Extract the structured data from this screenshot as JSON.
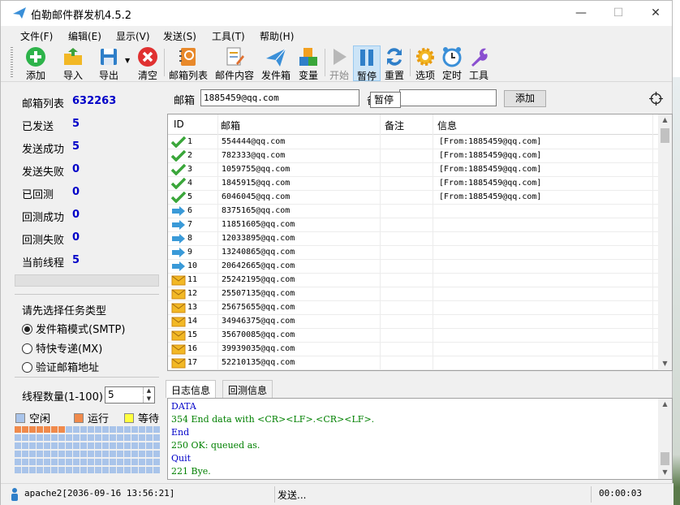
{
  "window": {
    "title": "伯勒邮件群发机4.5.2",
    "minimize": "—",
    "maximize": "☐",
    "close": "✕"
  },
  "menu": [
    "文件(F)",
    "编辑(E)",
    "显示(V)",
    "发送(S)",
    "工具(T)",
    "帮助(H)"
  ],
  "toolbar": {
    "add": "添加",
    "import": "导入",
    "export": "导出",
    "clear": "清空",
    "mail_list": "邮箱列表",
    "mail_content": "邮件内容",
    "outbox": "发件箱",
    "variable": "变量",
    "start": "开始",
    "pause": "暂停",
    "reset": "重置",
    "options": "选项",
    "timer": "定时",
    "tools": "工具"
  },
  "tooltip": "暂停",
  "stats": [
    {
      "label": "邮箱列表",
      "value": "632263"
    },
    {
      "label": "已发送",
      "value": "5"
    },
    {
      "label": "发送成功",
      "value": "5"
    },
    {
      "label": "发送失败",
      "value": "0"
    },
    {
      "label": "已回测",
      "value": "0"
    },
    {
      "label": "回测成功",
      "value": "0"
    },
    {
      "label": "回测失败",
      "value": "0"
    },
    {
      "label": "当前线程",
      "value": "5"
    }
  ],
  "task": {
    "prompt": "请先选择任务类型",
    "options": [
      "发件箱模式(SMTP)",
      "特快专递(MX)",
      "验证邮箱地址"
    ],
    "selected": 0
  },
  "threads": {
    "label": "线程数量(1-100)",
    "value": "5"
  },
  "legend": {
    "idle": "空闲",
    "running": "运行",
    "waiting": "等待"
  },
  "colors": {
    "idle": "#a9c4ea",
    "running": "#f08a4b",
    "waiting": "#ffff40",
    "accent": "#0000c8"
  },
  "address_bar": {
    "label": "邮箱",
    "value": "1885459@qq.com",
    "note_label": "备",
    "note_value": "",
    "add_button": "添加"
  },
  "table": {
    "columns": [
      "ID",
      "邮箱",
      "备注",
      "信息"
    ],
    "rows": [
      {
        "id": "1",
        "email": "554444@qq.com",
        "note": "",
        "info": "[From:1885459@qq.com]",
        "status": "done"
      },
      {
        "id": "2",
        "email": "782333@qq.com",
        "note": "",
        "info": "[From:1885459@qq.com]",
        "status": "done"
      },
      {
        "id": "3",
        "email": "1059755@qq.com",
        "note": "",
        "info": "[From:1885459@qq.com]",
        "status": "done"
      },
      {
        "id": "4",
        "email": "1845915@qq.com",
        "note": "",
        "info": "[From:1885459@qq.com]",
        "status": "done"
      },
      {
        "id": "5",
        "email": "6046045@qq.com",
        "note": "",
        "info": "[From:1885459@qq.com]",
        "status": "done"
      },
      {
        "id": "6",
        "email": "8375165@qq.com",
        "note": "",
        "info": "",
        "status": "sending"
      },
      {
        "id": "7",
        "email": "11851605@qq.com",
        "note": "",
        "info": "",
        "status": "sending"
      },
      {
        "id": "8",
        "email": "12033895@qq.com",
        "note": "",
        "info": "",
        "status": "sending"
      },
      {
        "id": "9",
        "email": "13240865@qq.com",
        "note": "",
        "info": "",
        "status": "sending"
      },
      {
        "id": "10",
        "email": "20642665@qq.com",
        "note": "",
        "info": "",
        "status": "sending"
      },
      {
        "id": "11",
        "email": "25242195@qq.com",
        "note": "",
        "info": "",
        "status": "queued"
      },
      {
        "id": "12",
        "email": "25507135@qq.com",
        "note": "",
        "info": "",
        "status": "queued"
      },
      {
        "id": "13",
        "email": "25675655@qq.com",
        "note": "",
        "info": "",
        "status": "queued"
      },
      {
        "id": "14",
        "email": "34946375@qq.com",
        "note": "",
        "info": "",
        "status": "queued"
      },
      {
        "id": "15",
        "email": "35670085@qq.com",
        "note": "",
        "info": "",
        "status": "queued"
      },
      {
        "id": "16",
        "email": "39939035@qq.com",
        "note": "",
        "info": "",
        "status": "queued"
      },
      {
        "id": "17",
        "email": "52210135@qq.com",
        "note": "",
        "info": "",
        "status": "queued"
      }
    ]
  },
  "tabs": [
    "日志信息",
    "回测信息"
  ],
  "log": [
    {
      "text": "DATA",
      "color": "#0000c8"
    },
    {
      "text": "354 End data with <CR><LF>.<CR><LF>.",
      "color": "#008000"
    },
    {
      "text": "End",
      "color": "#0000c8"
    },
    {
      "text": "250 OK: queued as.",
      "color": "#008000"
    },
    {
      "text": "Quit",
      "color": "#0000c8"
    },
    {
      "text": "221 Bye.",
      "color": "#008000"
    }
  ],
  "status": {
    "user": "apache2[2036-09-16 13:56:21]",
    "state": "发送...",
    "elapsed": "00:00:03"
  }
}
